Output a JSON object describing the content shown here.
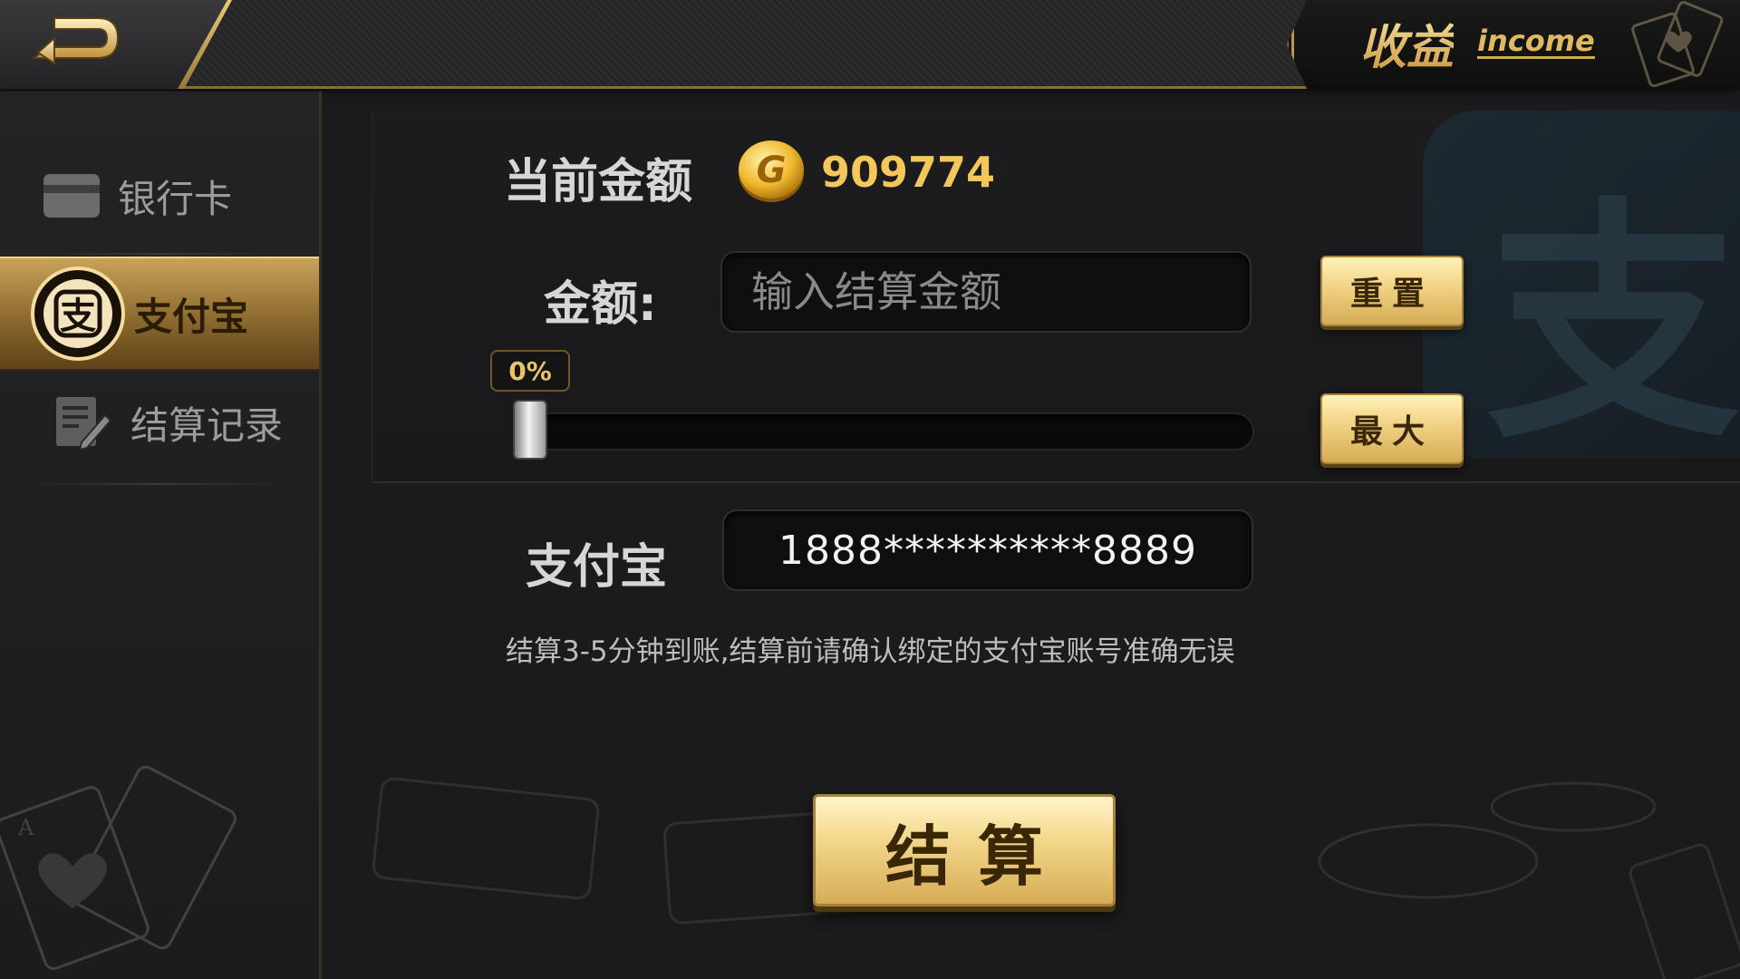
{
  "header": {
    "title_cn": "收益",
    "title_en": "income",
    "back_icon": "back-arrow-icon"
  },
  "sidebar": {
    "items": [
      {
        "label": "银行卡",
        "icon": "bank-card-icon",
        "active": false
      },
      {
        "label": "支付宝",
        "icon": "alipay-icon",
        "active": true
      },
      {
        "label": "结算记录",
        "icon": "record-edit-icon",
        "active": false
      }
    ]
  },
  "main": {
    "balance_label": "当前金额",
    "balance_value": "909774",
    "amount_label": "金额:",
    "amount_placeholder": "输入结算金额",
    "amount_value": "",
    "reset_label": "重置",
    "max_label": "最大",
    "slider_percent_label": "0%",
    "slider_value": 0,
    "account_label": "支付宝",
    "account_value": "1888**********8889",
    "notice": "结算3-5分钟到账,结算前请确认绑定的支付宝账号准确无误",
    "submit_label": "结算",
    "watermark_char": "支"
  },
  "colors": {
    "gold": "#e9c46f",
    "background": "#1b1b1d",
    "balance": "#f4c75a"
  }
}
